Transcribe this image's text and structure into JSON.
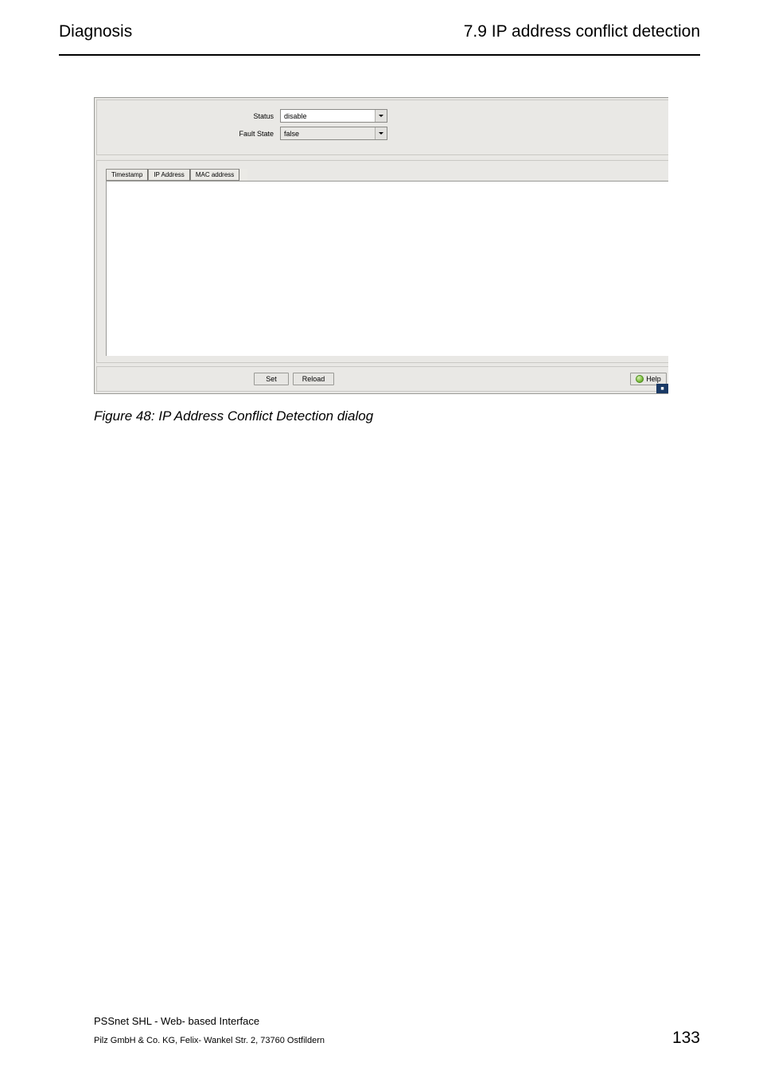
{
  "header": {
    "left": "Diagnosis",
    "right": "7.9  IP address conflict detection"
  },
  "dialog": {
    "status": {
      "label": "Status",
      "value": "disable"
    },
    "fault_state": {
      "label": "Fault State",
      "value": "false"
    },
    "table": {
      "col1": "Timestamp",
      "col2": "IP Address",
      "col3": "MAC address"
    },
    "buttons": {
      "set": "Set",
      "reload": "Reload",
      "help": "Help"
    }
  },
  "caption": "Figure 48: IP Address Conflict Detection dialog",
  "footer": {
    "title": "PSSnet SHL - Web- based Interface",
    "address": "Pilz GmbH & Co. KG, Felix- Wankel Str. 2, 73760 Ostfildern",
    "page": "133"
  }
}
